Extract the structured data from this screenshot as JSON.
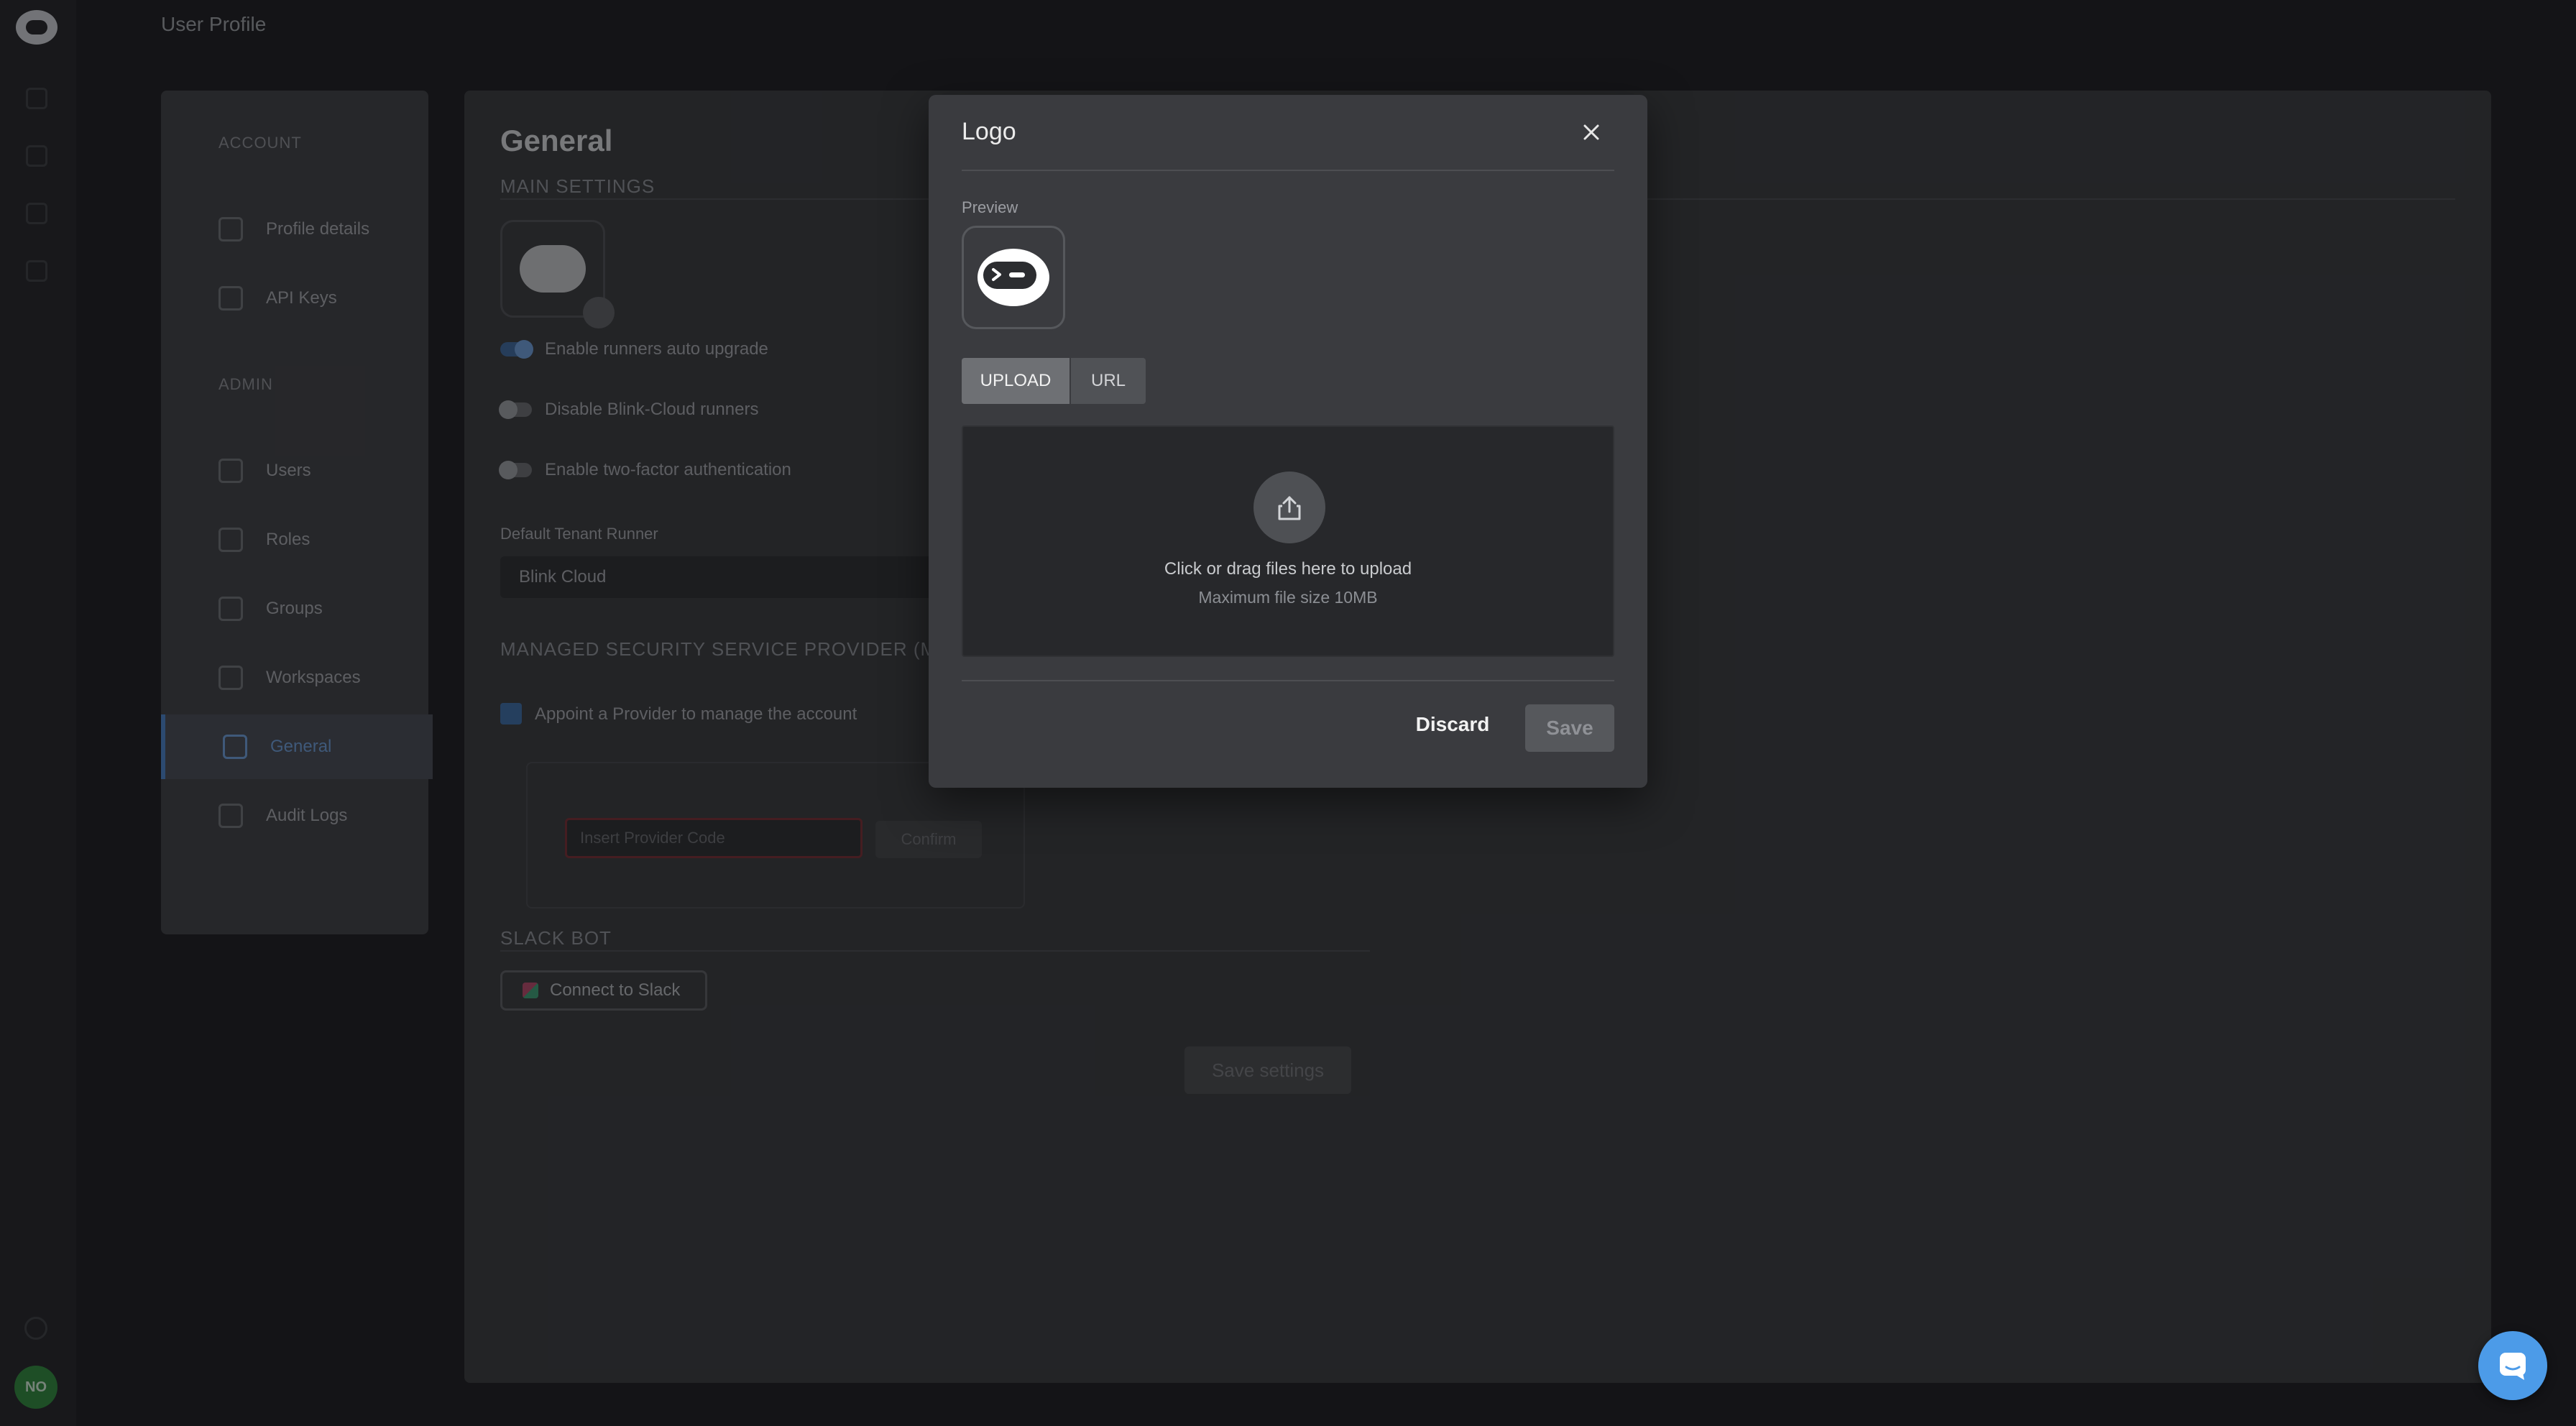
{
  "topbar": {
    "title": "User Profile"
  },
  "rail": {
    "avatar_initials": "NO"
  },
  "nav": {
    "account_label": "ACCOUNT",
    "admin_label": "ADMIN",
    "items": [
      {
        "label": "Profile details",
        "icon": "person-icon"
      },
      {
        "label": "API Keys",
        "icon": "code-icon"
      },
      {
        "label": "Users",
        "icon": "users-icon"
      },
      {
        "label": "Roles",
        "icon": "briefcase-icon"
      },
      {
        "label": "Groups",
        "icon": "list-icon"
      },
      {
        "label": "Workspaces",
        "icon": "globe-icon"
      },
      {
        "label": "General",
        "icon": "gear-icon",
        "active": true
      },
      {
        "label": "Audit Logs",
        "icon": "clock-icon"
      }
    ]
  },
  "general": {
    "title": "General",
    "main_settings": "MAIN SETTINGS",
    "toggles": [
      {
        "label": "Enable runners auto upgrade",
        "on": true
      },
      {
        "label": "Disable Blink-Cloud runners",
        "on": false
      },
      {
        "label": "Enable two-factor authentication",
        "on": false
      }
    ],
    "default_runner_label": "Default Tenant Runner",
    "default_runner_value": "Blink Cloud",
    "mssp_heading": "MANAGED SECURITY SERVICE PROVIDER (MSSP)",
    "appoint_label": "Appoint a Provider to manage the account",
    "provider_placeholder": "Insert Provider Code",
    "confirm_label": "Confirm",
    "slack_heading": "SLACK BOT",
    "slack_button": "Connect to Slack",
    "save_settings": "Save settings"
  },
  "modal": {
    "title": "Logo",
    "close_icon": "close-icon",
    "preview_label": "Preview",
    "tabs": {
      "upload": "UPLOAD",
      "url": "URL",
      "selected": "UPLOAD"
    },
    "dropzone": {
      "primary": "Click or drag files here to upload",
      "secondary": "Maximum file size 10MB",
      "icon": "upload-icon"
    },
    "discard_label": "Discard",
    "save_label": "Save"
  },
  "colors": {
    "accent": "#4a83c9",
    "chat_button": "#4c9be8",
    "avatar": "#2e8b3c"
  }
}
